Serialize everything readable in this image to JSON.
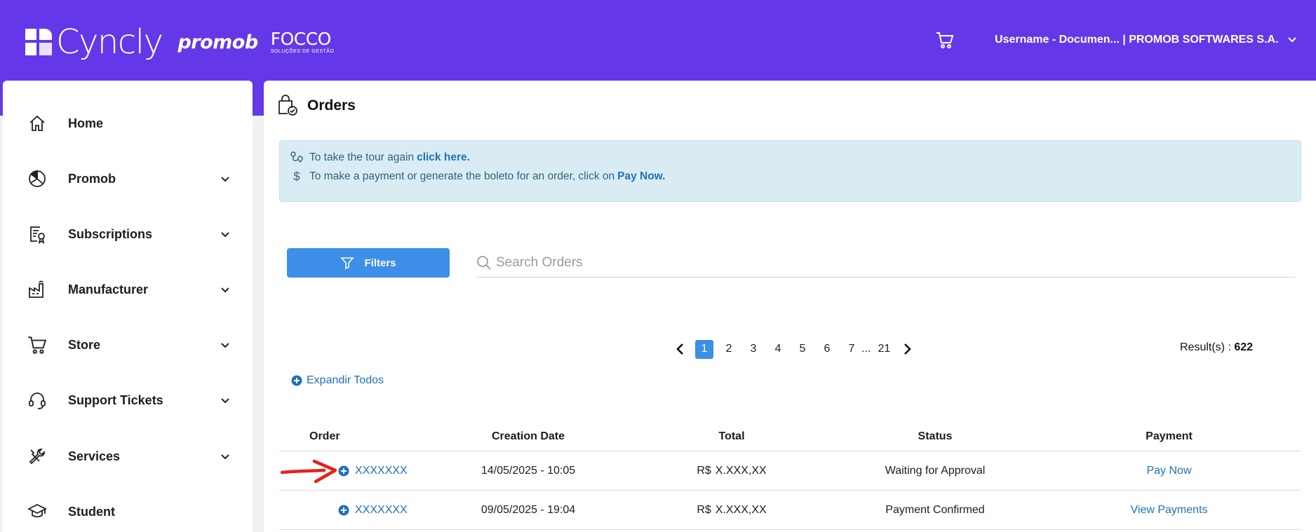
{
  "header": {
    "brand_primary": "Cyncly",
    "brand_secondary": "promob",
    "brand_tertiary": "FOCCO",
    "brand_tertiary_sub": "SOLUÇÕES DE GESTÃO",
    "cart_icon": "cart-icon",
    "user_label": "Username - Documen... | PROMOB SOFTWARES S.A.",
    "accent_color": "#6438e8"
  },
  "sidebar": {
    "items": [
      {
        "label": "Home",
        "icon": "home-icon",
        "has_submenu": false
      },
      {
        "label": "Promob",
        "icon": "promob-icon",
        "has_submenu": true
      },
      {
        "label": "Subscriptions",
        "icon": "certificate-icon",
        "has_submenu": true
      },
      {
        "label": "Manufacturer",
        "icon": "factory-icon",
        "has_submenu": true
      },
      {
        "label": "Store",
        "icon": "cart-icon",
        "has_submenu": true
      },
      {
        "label": "Support Tickets",
        "icon": "headset-icon",
        "has_submenu": true
      },
      {
        "label": "Services",
        "icon": "tools-icon",
        "has_submenu": true
      },
      {
        "label": "Student",
        "icon": "graduation-cap-icon",
        "has_submenu": false
      }
    ]
  },
  "page": {
    "title": "Orders",
    "title_icon": "orders-bag-check-icon"
  },
  "info": {
    "tour_text": "To take the tour again",
    "tour_link": "click here.",
    "payment_text": "To make a payment or generate the boleto for an order, click on",
    "payment_link": "Pay Now."
  },
  "toolbar": {
    "filters_label": "Filters",
    "search_placeholder": "Search Orders"
  },
  "pagination": {
    "pages": [
      "1",
      "2",
      "3",
      "4",
      "5",
      "6",
      "7"
    ],
    "current": "1",
    "ellipsis": "...",
    "last_page": "21",
    "results_label": "Result(s) :",
    "results_count": "622"
  },
  "expand_all_label": "Expandir Todos",
  "table": {
    "columns": [
      "Order",
      "Creation Date",
      "Total",
      "Status",
      "Payment"
    ],
    "rows": [
      {
        "order": "XXXXXXX",
        "date": "14/05/2025 - 10:05",
        "currency": "R$",
        "total": "X.XXX,XX",
        "status": "Waiting for Approval",
        "payment": "Pay Now"
      },
      {
        "order": "XXXXXXX",
        "date": "09/05/2025 - 19:04",
        "currency": "R$",
        "total": "X.XXX,XX",
        "status": "Payment Confirmed",
        "payment": "View Payments"
      }
    ]
  },
  "annotation": {
    "arrow_color": "#e8201c"
  }
}
